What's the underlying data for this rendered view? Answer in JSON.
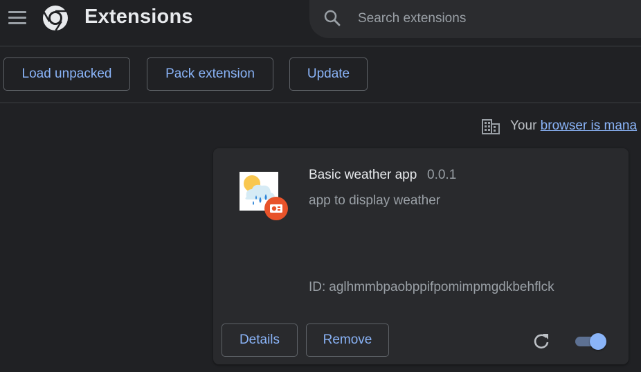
{
  "header": {
    "title": "Extensions",
    "search_placeholder": "Search extensions",
    "search_value": ""
  },
  "toolbar": {
    "load_unpacked": "Load unpacked",
    "pack_extension": "Pack extension",
    "update": "Update"
  },
  "managed_notice": {
    "prefix": "Your ",
    "link_text": "browser is mana"
  },
  "extension": {
    "name": "Basic weather app",
    "version": "0.0.1",
    "description": "app to display weather",
    "id_label": "ID:",
    "id_value": "aglhmmbpaobppifpomimpmgdkbehflck",
    "details_label": "Details",
    "remove_label": "Remove",
    "enabled": true
  },
  "icons": {
    "menu": "hamburger-menu-icon",
    "logo": "chrome-logo-icon",
    "search": "search-icon",
    "managed": "building-icon",
    "extension": "weather-icon",
    "badge": "developer-mode-badge-icon",
    "reload": "reload-icon"
  },
  "colors": {
    "background": "#202124",
    "card": "#292a2d",
    "accent": "#8ab4f8",
    "border": "#5f6368",
    "badge": "#e8532a"
  }
}
